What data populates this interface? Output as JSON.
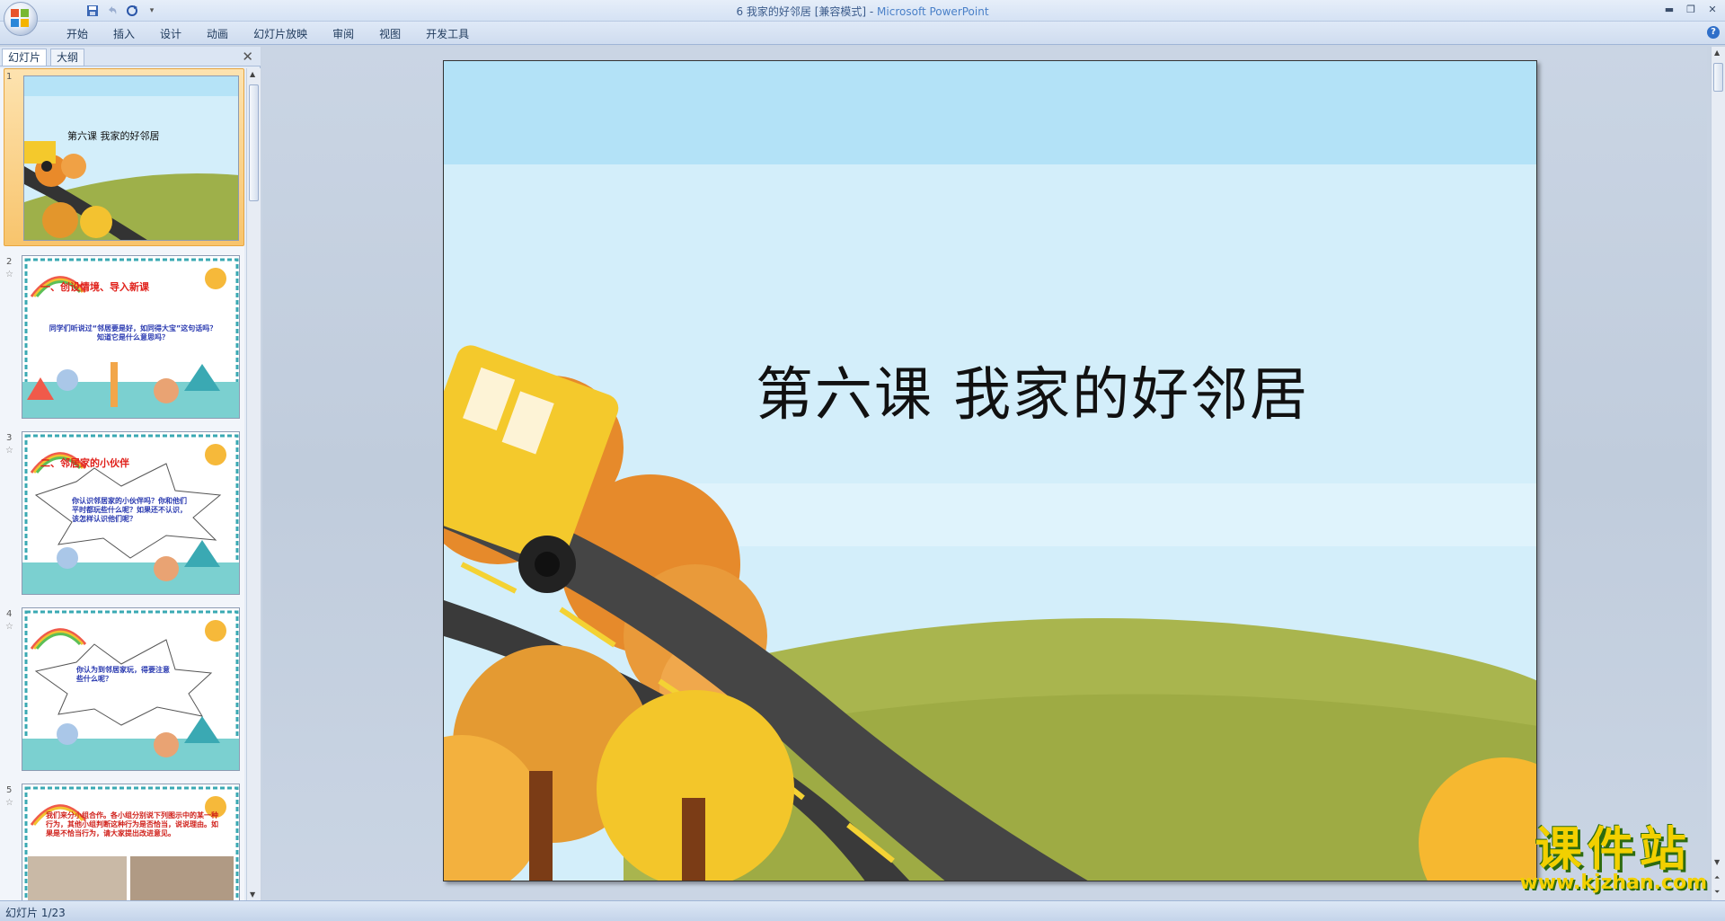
{
  "window": {
    "title": "6 我家的好邻居 [兼容模式] - ",
    "app_name": "Microsoft PowerPoint"
  },
  "ribbon": {
    "tabs": [
      "开始",
      "插入",
      "设计",
      "动画",
      "幻灯片放映",
      "审阅",
      "视图",
      "开发工具"
    ]
  },
  "left_panel": {
    "tab_slides": "幻灯片",
    "tab_outline": "大纲",
    "thumbnails": [
      {
        "num": "1",
        "title": "第六课  我家的好邻居",
        "text": ""
      },
      {
        "num": "2",
        "title": "一、创设情境、导入新课",
        "text": "同学们听说过“邻居要是好，如同得大宝”这句话吗？知道它是什么意思吗？"
      },
      {
        "num": "3",
        "title": "二、邻居家的小伙伴",
        "text": "你认识邻居家的小伙伴吗？你和他们平时都玩些什么呢？如果还不认识，该怎样认识他们呢？"
      },
      {
        "num": "4",
        "title": "",
        "text": "你认为到邻居家玩，得要注意些什么呢？"
      },
      {
        "num": "5",
        "title": "",
        "text": "我们来分小组合作。各小组分别说下列图示中的某一种行为，其他小组判断这种行为是否恰当，说说理由。如果是不恰当行为，请大家提出改进意见。"
      }
    ]
  },
  "slide": {
    "title": "第六课  我家的好邻居"
  },
  "status": {
    "slide_counter": "幻灯片 1/23"
  },
  "watermark": {
    "main": "课件站",
    "sub": "www.kjzhan.com"
  }
}
